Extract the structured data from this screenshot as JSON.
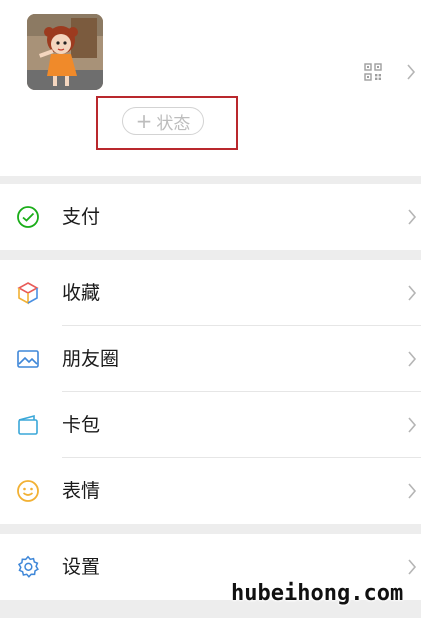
{
  "profile": {
    "status_plus": "+",
    "status_label": "状态"
  },
  "menu": {
    "pay": {
      "label": "支付",
      "icon": "pay-icon"
    },
    "favorites": {
      "label": "收藏",
      "icon": "cube-icon"
    },
    "moments": {
      "label": "朋友圈",
      "icon": "image-icon"
    },
    "cards": {
      "label": "卡包",
      "icon": "wallet-icon"
    },
    "stickers": {
      "label": "表情",
      "icon": "smile-icon"
    },
    "settings": {
      "label": "设置",
      "icon": "gear-icon"
    }
  },
  "watermark": "hubeihong.com",
  "colors": {
    "highlight_border": "#b9282d",
    "pay_green": "#1aad19",
    "section_gap": "#ededed"
  }
}
